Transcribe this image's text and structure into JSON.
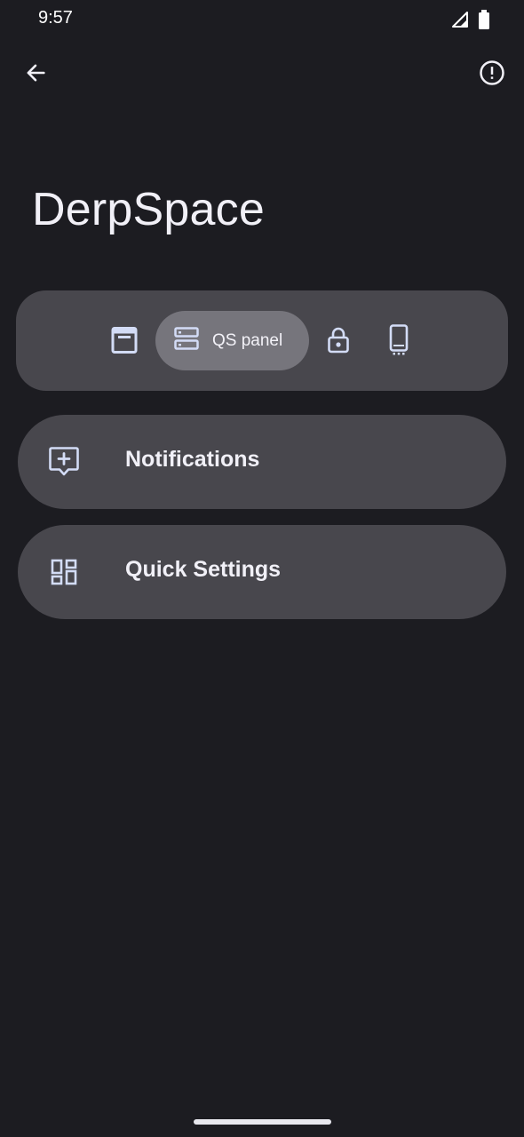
{
  "status_bar": {
    "time": "9:57",
    "icons": [
      "signal-icon",
      "battery-icon"
    ]
  },
  "app_bar": {
    "back_icon": "back-arrow-icon",
    "info_icon": "info-icon"
  },
  "page": {
    "title": "DerpSpace"
  },
  "tabs": [
    {
      "id": "statusbar",
      "icon": "statusbar-icon",
      "label": ""
    },
    {
      "id": "qs",
      "icon": "qs-panel-icon",
      "label": "QS panel",
      "selected": true
    },
    {
      "id": "lockscreen",
      "icon": "lock-icon",
      "label": ""
    },
    {
      "id": "device",
      "icon": "device-icon",
      "label": ""
    }
  ],
  "list": {
    "items": [
      {
        "label": "Notifications",
        "icon": "add-notification-icon"
      },
      {
        "label": "Quick Settings",
        "icon": "dashboard-icon"
      }
    ]
  },
  "colors": {
    "background": "#1c1c21",
    "surface": "#48474d",
    "selected_tab": "#76757c",
    "icon_tint": "#d3dcf6",
    "text": "#f1f0f7"
  }
}
